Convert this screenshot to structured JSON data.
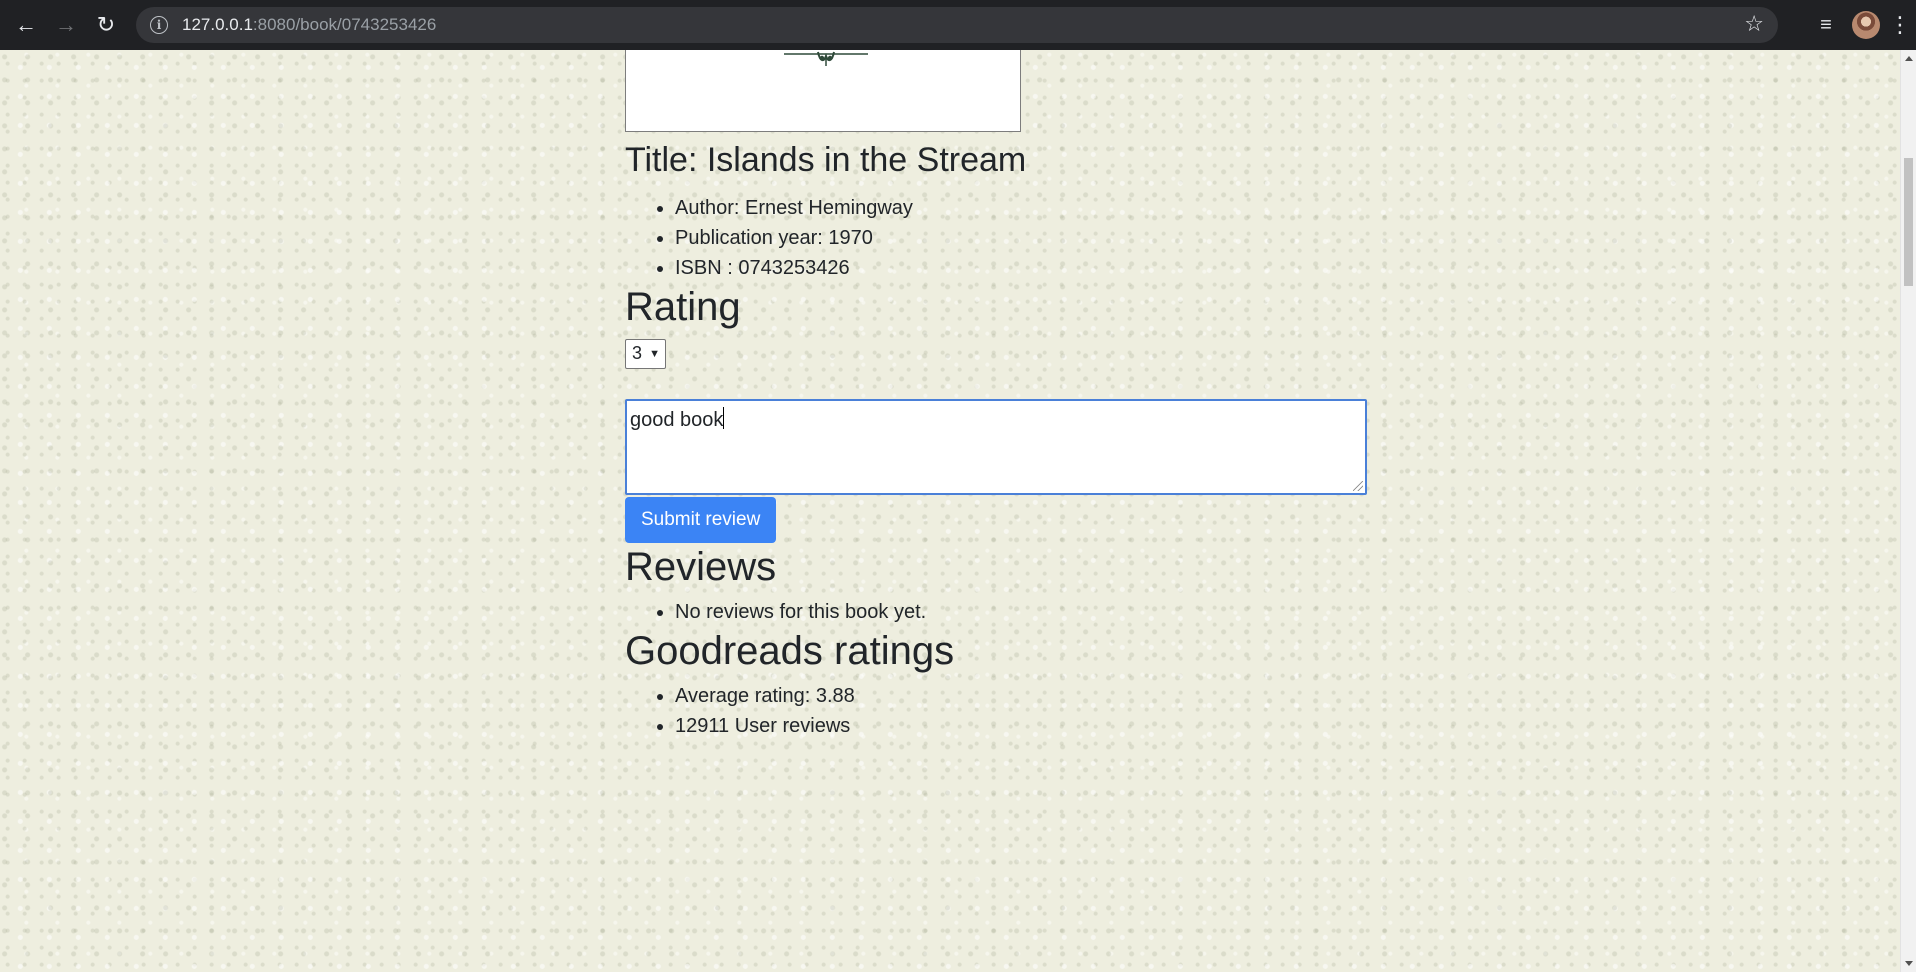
{
  "browser": {
    "url_host": "127.0.0.1",
    "url_path": ":8080/book/0743253426",
    "icons": {
      "back": "back-arrow-icon",
      "forward": "forward-arrow-icon",
      "reload": "reload-icon",
      "info": "info-icon",
      "bookmark": "star-icon",
      "media": "media-control-icon",
      "profile": "avatar",
      "menu": "kebab-menu-icon"
    }
  },
  "book": {
    "title_label": "Title: Islands in the Stream",
    "details": [
      "Author: Ernest Hemingway",
      "Publication year: 1970",
      "ISBN : 0743253426"
    ]
  },
  "rating": {
    "heading": "Rating",
    "selected": "3",
    "review_text": "good book",
    "submit_label": "Submit review"
  },
  "reviews": {
    "heading": "Reviews",
    "items": [
      "No reviews for this book yet."
    ]
  },
  "goodreads": {
    "heading": "Goodreads ratings",
    "items": [
      "Average rating: 3.88",
      "12911 User reviews"
    ]
  },
  "colors": {
    "chrome_bg": "#202124",
    "page_bg": "#eeeedf",
    "button_primary": "#3b84f5",
    "focus_border": "#4a80d8"
  }
}
